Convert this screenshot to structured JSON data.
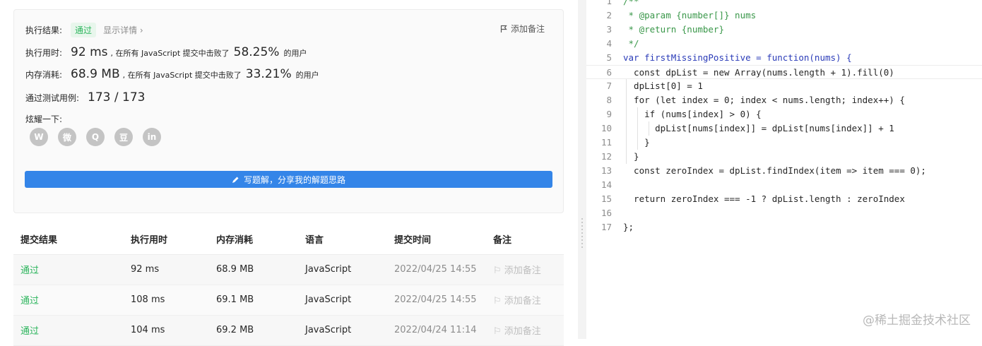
{
  "result_card": {
    "exec_result_label": "执行结果:",
    "status": "通过",
    "show_details": "显示详情 ›",
    "add_note": "添加备注",
    "runtime_label": "执行用时:",
    "runtime_value": "92 ms",
    "runtime_middle": ", 在所有 JavaScript 提交中击败了",
    "runtime_pct": "58.25%",
    "users_suffix": "的用户",
    "memory_label": "内存消耗:",
    "memory_value": "68.9 MB",
    "memory_middle": ", 在所有 JavaScript 提交中击败了",
    "memory_pct": "33.21%",
    "tests_label": "通过测试用例:",
    "tests_value": "173 / 173",
    "share_label": "炫耀一下:",
    "share_icons": [
      "wechat-icon",
      "weibo-icon",
      "qq-icon",
      "douban-icon",
      "linkedin-icon"
    ],
    "share_glyphs": [
      "W",
      "微",
      "Q",
      "豆",
      "in"
    ],
    "write_solution": "写题解，分享我的解题思路"
  },
  "submissions": {
    "headers": [
      "提交结果",
      "执行用时",
      "内存消耗",
      "语言",
      "提交时间",
      "备注"
    ],
    "rows": [
      {
        "result": "通过",
        "runtime": "92 ms",
        "memory": "68.9 MB",
        "lang": "JavaScript",
        "time": "2022/04/25 14:55",
        "note": "添加备注"
      },
      {
        "result": "通过",
        "runtime": "108 ms",
        "memory": "69.1 MB",
        "lang": "JavaScript",
        "time": "2022/04/25 14:55",
        "note": "添加备注"
      },
      {
        "result": "通过",
        "runtime": "104 ms",
        "memory": "69.2 MB",
        "lang": "JavaScript",
        "time": "2022/04/24 11:14",
        "note": "添加备注"
      }
    ]
  },
  "editor": {
    "active_line": 6,
    "lines": [
      "/**",
      " * @param {number[]} nums",
      " * @return {number}",
      " */",
      "var firstMissingPositive = function(nums) {",
      "  const dpList = new Array(nums.length + 1).fill(0)",
      "  dpList[0] = 1",
      "  for (let index = 0; index < nums.length; index++) {",
      "    if (nums[index] > 0) {",
      "      dpList[nums[index]] = dpList[nums[index]] + 1",
      "    }",
      "  }",
      "  const zeroIndex = dpList.findIndex(item => item === 0);",
      "",
      "  return zeroIndex === -1 ? dpList.length : zeroIndex",
      "",
      "};"
    ]
  },
  "watermark": "@稀土掘金技术社区",
  "colors": {
    "accent": "#3485e8",
    "success": "#2db55d"
  }
}
